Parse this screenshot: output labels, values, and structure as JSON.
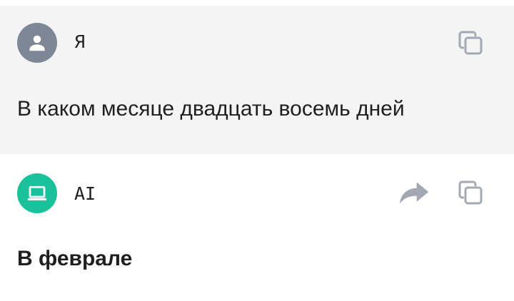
{
  "colors": {
    "user_avatar": "#7d8795",
    "ai_avatar": "#19c29a",
    "icon": "#a3a9b3"
  },
  "messages": [
    {
      "sender": "Я",
      "avatar_icon": "person-icon",
      "text": "В каком месяце двадцать восемь дней",
      "actions": [
        "copy-icon"
      ]
    },
    {
      "sender": "AI",
      "avatar_icon": "laptop-icon",
      "text": "В феврале",
      "actions": [
        "share-icon",
        "copy-icon"
      ]
    }
  ]
}
